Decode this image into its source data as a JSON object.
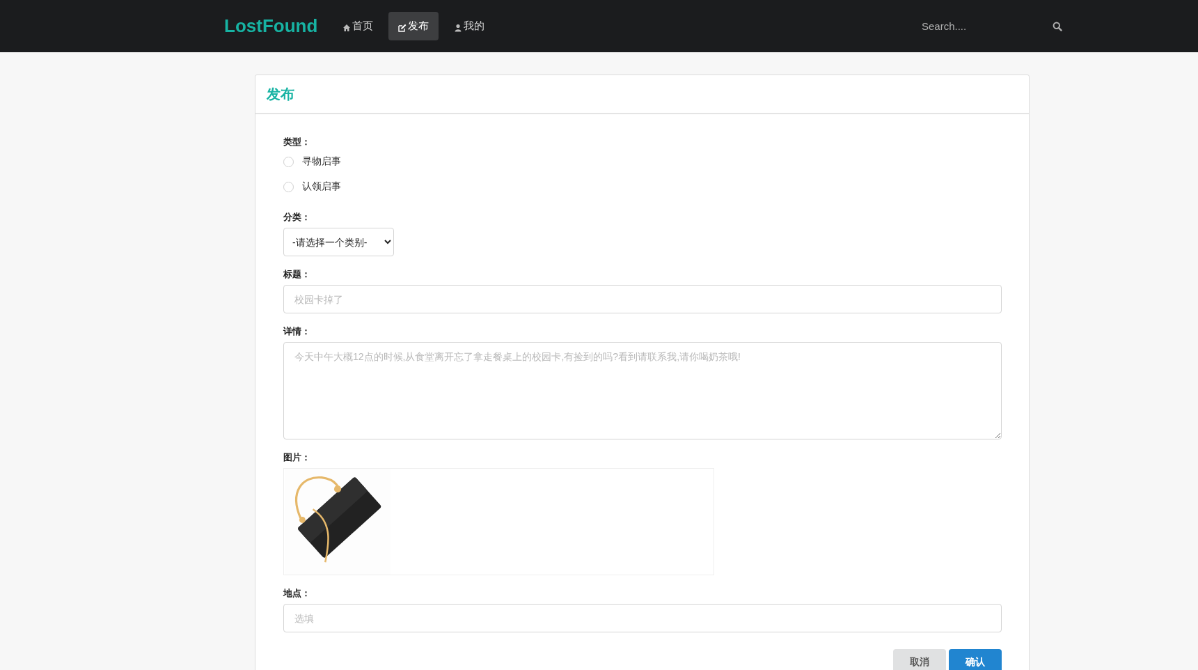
{
  "navbar": {
    "brand": "LostFound",
    "items": [
      {
        "label": "首页",
        "kind": "home",
        "selected": false
      },
      {
        "label": "发布",
        "kind": "edit",
        "selected": true
      },
      {
        "label": "我的",
        "kind": "user",
        "selected": false
      }
    ],
    "search": {
      "placeholder": "Search...."
    }
  },
  "card": {
    "title": "发布",
    "fields": [
      {
        "kind": "radio",
        "label": "类型：",
        "options": [
          {
            "label": "寻物启事",
            "selected": false
          },
          {
            "label": "认领启事",
            "selected": false
          }
        ]
      },
      {
        "kind": "select",
        "label": "分类：",
        "value": "-请选择一个类别-"
      },
      {
        "kind": "text",
        "label": "标题：",
        "placeholder": "校园卡掉了"
      },
      {
        "kind": "textarea",
        "label": "详情：",
        "placeholder": "今天中午大概12点的时候,从食堂离开忘了拿走餐桌上的校园卡,有捡到的吗?看到请联系我,请你喝奶茶哦!"
      },
      {
        "label": "图片："
      },
      {
        "kind": "text",
        "label": "地点：",
        "placeholder": "选填"
      }
    ],
    "buttons": [
      {
        "label": "取消",
        "kind": "secondary"
      },
      {
        "label": "确认",
        "kind": "primary"
      }
    ]
  }
}
